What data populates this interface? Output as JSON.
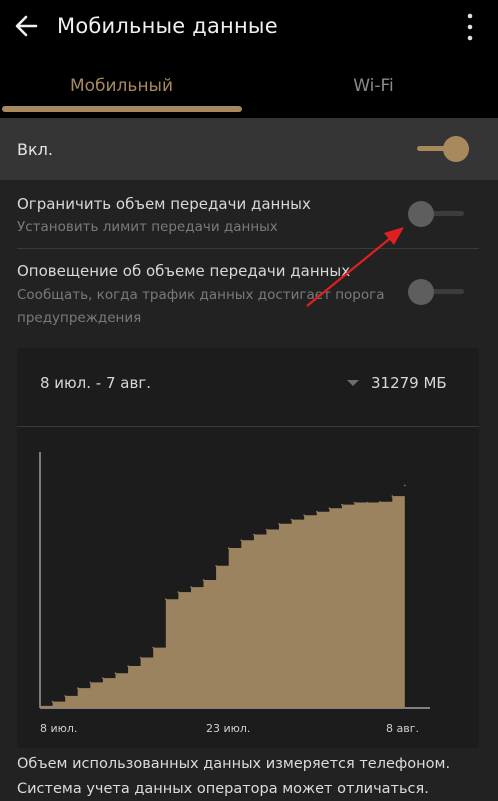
{
  "appbar": {
    "title": "Мобильные данные",
    "back_icon": "arrow-back-icon",
    "more_icon": "more-vert-icon"
  },
  "tabs": [
    {
      "label": "Мобильный",
      "selected": true
    },
    {
      "label": "Wi-Fi",
      "selected": false
    }
  ],
  "main_toggle": {
    "label": "Вкл.",
    "state": "on"
  },
  "settings": [
    {
      "title": "Ограничить объем передачи данных",
      "subtitle": "Установить лимит передачи данных",
      "state": "off"
    },
    {
      "title": "Оповещение об объеме передачи данных",
      "subtitle_line1": "Сообщать, когда трафик данных достигает порога",
      "subtitle_line2": "предупреждения",
      "state": "off"
    }
  ],
  "usage": {
    "period": "8 июл. - 7 авг.",
    "amount": "31279 МБ"
  },
  "chart_data": {
    "type": "area",
    "x_ticks": [
      "8 июл.",
      "23 июл.",
      "8 авг."
    ],
    "x": [
      0,
      1,
      2,
      3,
      4,
      5,
      6,
      7,
      8,
      9,
      10,
      11,
      12,
      13,
      14,
      15,
      16,
      17,
      18,
      19,
      20,
      21,
      22,
      23,
      24,
      25,
      26,
      27,
      28,
      29
    ],
    "values": [
      0.3,
      0.9,
      1.7,
      2.8,
      3.6,
      4.2,
      4.9,
      5.9,
      7.1,
      8.5,
      15.3,
      16.3,
      17.0,
      18.0,
      20.0,
      22.5,
      23.6,
      24.4,
      25.1,
      25.9,
      26.5,
      27.1,
      27.6,
      28.1,
      28.6,
      28.9,
      28.9,
      29.0,
      29.8,
      31.3
    ],
    "unit": "ГБ",
    "xlim": [
      0,
      31
    ],
    "ylim": [
      0,
      36
    ],
    "color": "#9c835f",
    "grid": false
  },
  "footer": {
    "line1": "Объем использованных данных измеряется телефоном.",
    "line2": "Система учета данных оператора может отличаться."
  },
  "colors": {
    "accent": "#a8895e",
    "background": "#222222",
    "appbar": "#000000",
    "annotation_arrow": "#e02020"
  }
}
